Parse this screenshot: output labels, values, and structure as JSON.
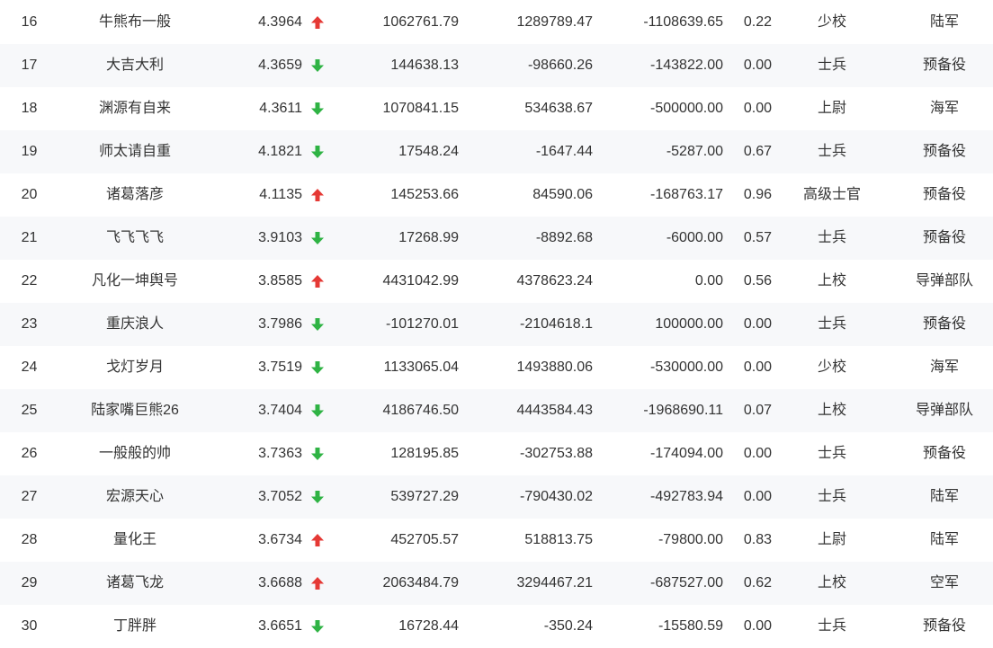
{
  "colors": {
    "up": "#e53935",
    "down": "#2fb344",
    "stripe": "#f7f8fa",
    "text": "#333333"
  },
  "rows": [
    {
      "rank": "16",
      "name": "牛熊布一般",
      "score": "4.3964",
      "trend": "up",
      "v1": "1062761.79",
      "v2": "1289789.47",
      "v3": "-1108639.65",
      "ratio": "0.22",
      "title": "少校",
      "branch": "陆军"
    },
    {
      "rank": "17",
      "name": "大吉大利",
      "score": "4.3659",
      "trend": "down",
      "v1": "144638.13",
      "v2": "-98660.26",
      "v3": "-143822.00",
      "ratio": "0.00",
      "title": "士兵",
      "branch": "预备役"
    },
    {
      "rank": "18",
      "name": "渊源有自来",
      "score": "4.3611",
      "trend": "down",
      "v1": "1070841.15",
      "v2": "534638.67",
      "v3": "-500000.00",
      "ratio": "0.00",
      "title": "上尉",
      "branch": "海军"
    },
    {
      "rank": "19",
      "name": "师太请自重",
      "score": "4.1821",
      "trend": "down",
      "v1": "17548.24",
      "v2": "-1647.44",
      "v3": "-5287.00",
      "ratio": "0.67",
      "title": "士兵",
      "branch": "预备役"
    },
    {
      "rank": "20",
      "name": "诸葛落彦",
      "score": "4.1135",
      "trend": "up",
      "v1": "145253.66",
      "v2": "84590.06",
      "v3": "-168763.17",
      "ratio": "0.96",
      "title": "高级士官",
      "branch": "预备役"
    },
    {
      "rank": "21",
      "name": "飞飞飞飞",
      "score": "3.9103",
      "trend": "down",
      "v1": "17268.99",
      "v2": "-8892.68",
      "v3": "-6000.00",
      "ratio": "0.57",
      "title": "士兵",
      "branch": "预备役"
    },
    {
      "rank": "22",
      "name": "凡化一坤舆号",
      "score": "3.8585",
      "trend": "up",
      "v1": "4431042.99",
      "v2": "4378623.24",
      "v3": "0.00",
      "ratio": "0.56",
      "title": "上校",
      "branch": "导弹部队"
    },
    {
      "rank": "23",
      "name": "重庆浪人",
      "score": "3.7986",
      "trend": "down",
      "v1": "-101270.01",
      "v2": "-2104618.1",
      "v3": "100000.00",
      "ratio": "0.00",
      "title": "士兵",
      "branch": "预备役"
    },
    {
      "rank": "24",
      "name": "戈灯岁月",
      "score": "3.7519",
      "trend": "down",
      "v1": "1133065.04",
      "v2": "1493880.06",
      "v3": "-530000.00",
      "ratio": "0.00",
      "title": "少校",
      "branch": "海军"
    },
    {
      "rank": "25",
      "name": "陆家嘴巨熊26",
      "score": "3.7404",
      "trend": "down",
      "v1": "4186746.50",
      "v2": "4443584.43",
      "v3": "-1968690.11",
      "ratio": "0.07",
      "title": "上校",
      "branch": "导弹部队"
    },
    {
      "rank": "26",
      "name": "一般般的帅",
      "score": "3.7363",
      "trend": "down",
      "v1": "128195.85",
      "v2": "-302753.88",
      "v3": "-174094.00",
      "ratio": "0.00",
      "title": "士兵",
      "branch": "预备役"
    },
    {
      "rank": "27",
      "name": "宏源天心",
      "score": "3.7052",
      "trend": "down",
      "v1": "539727.29",
      "v2": "-790430.02",
      "v3": "-492783.94",
      "ratio": "0.00",
      "title": "士兵",
      "branch": "陆军"
    },
    {
      "rank": "28",
      "name": "量化王",
      "score": "3.6734",
      "trend": "up",
      "v1": "452705.57",
      "v2": "518813.75",
      "v3": "-79800.00",
      "ratio": "0.83",
      "title": "上尉",
      "branch": "陆军"
    },
    {
      "rank": "29",
      "name": "诸葛飞龙",
      "score": "3.6688",
      "trend": "up",
      "v1": "2063484.79",
      "v2": "3294467.21",
      "v3": "-687527.00",
      "ratio": "0.62",
      "title": "上校",
      "branch": "空军"
    },
    {
      "rank": "30",
      "name": "丁胖胖",
      "score": "3.6651",
      "trend": "down",
      "v1": "16728.44",
      "v2": "-350.24",
      "v3": "-15580.59",
      "ratio": "0.00",
      "title": "士兵",
      "branch": "预备役"
    }
  ]
}
